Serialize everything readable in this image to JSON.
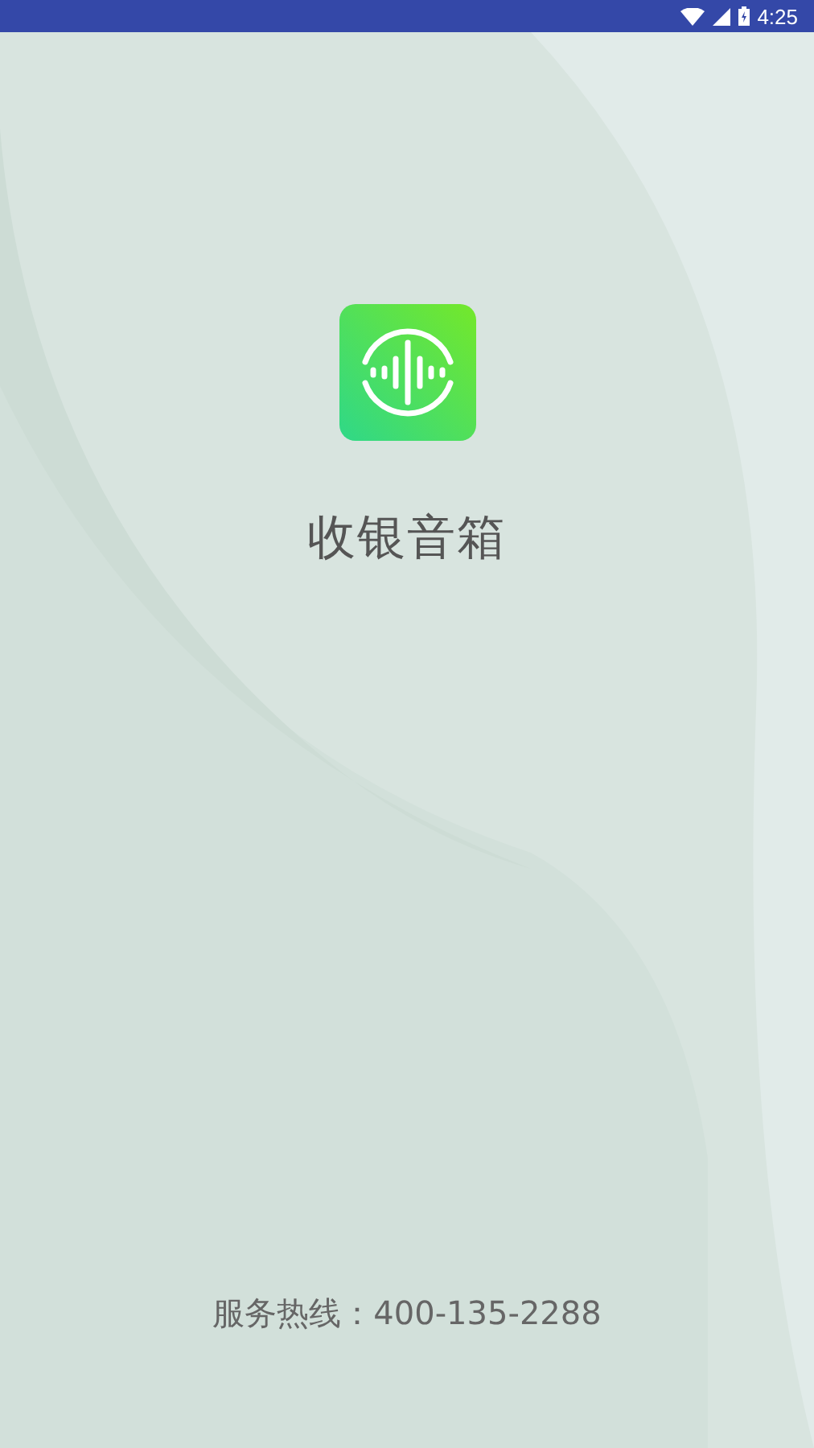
{
  "status_bar": {
    "time": "4:25"
  },
  "app": {
    "name": "收银音箱"
  },
  "footer": {
    "hotline": "服务热线：400-135-2288"
  }
}
